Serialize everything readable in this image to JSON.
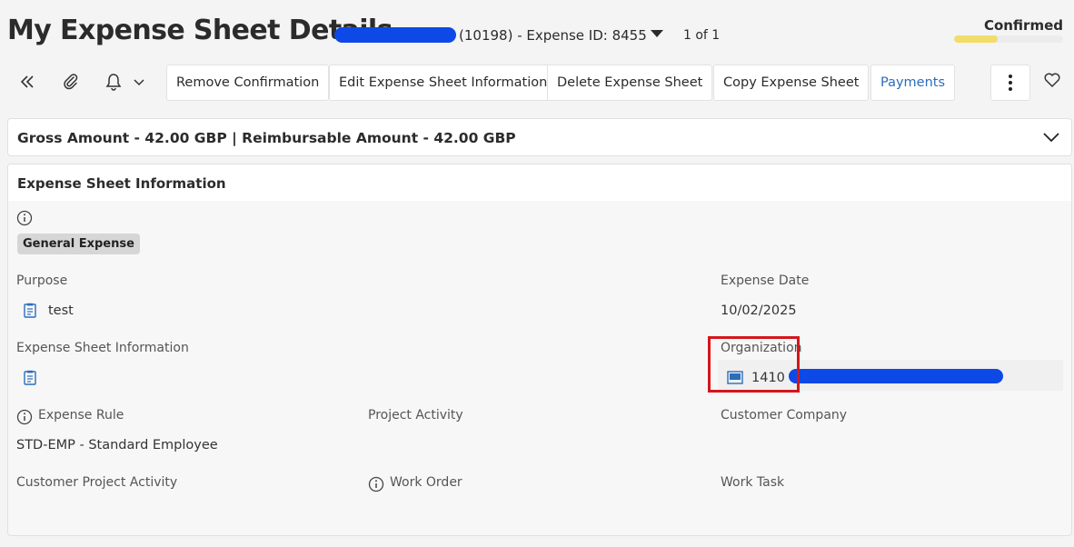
{
  "header": {
    "title": "My Expense Sheet Details",
    "record_id": "(10198) - Expense ID: 8455",
    "pager": "1 of 1",
    "status": "Confirmed",
    "status_progress": 0.4
  },
  "toolbar": {
    "buttons": [
      "Remove Confirmation",
      "Edit Expense Sheet Information",
      "Delete Expense Sheet",
      "Copy Expense Sheet",
      "Payments"
    ]
  },
  "summary": {
    "text": "Gross Amount - 42.00 GBP | Reimbursable Amount - 42.00 GBP"
  },
  "info": {
    "title": "Expense Sheet Information",
    "badge": "General Expense",
    "purpose_label": "Purpose",
    "purpose_value": "test",
    "expense_date_label": "Expense Date",
    "expense_date_value": "10/02/2025",
    "sheet_info_label": "Expense Sheet Information",
    "organization_label": "Organization",
    "organization_value": "1410 -",
    "expense_rule_label": "Expense Rule",
    "expense_rule_value": "STD-EMP - Standard Employee",
    "project_activity_label": "Project Activity",
    "customer_company_label": "Customer Company",
    "customer_project_activity_label": "Customer Project Activity",
    "work_order_label": "Work Order",
    "work_task_label": "Work Task"
  },
  "colors": {
    "accent_link": "#2a6ebb",
    "redaction": "#0d49e6",
    "highlight": "#d4161c",
    "status": "#f2dd6b"
  },
  "icons": [
    "double-chevron-left-icon",
    "paperclip-icon",
    "bell-icon",
    "chevron-down-icon",
    "kebab-menu-icon",
    "heart-icon",
    "info-icon",
    "document-icon",
    "organization-icon"
  ]
}
